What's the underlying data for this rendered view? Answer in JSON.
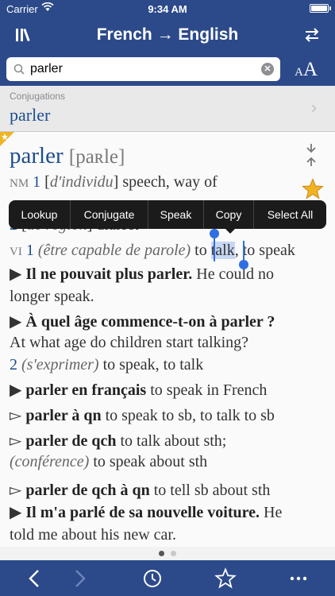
{
  "status": {
    "carrier": "Carrier",
    "time": "9:34 AM"
  },
  "nav": {
    "title": "French → English"
  },
  "search": {
    "value": "parler",
    "placeholder": ""
  },
  "text_size": {
    "small": "A",
    "big": "A"
  },
  "conjugations": {
    "label": "Conjugations",
    "word": "parler"
  },
  "entry": {
    "headword": "parler",
    "pronunciation": "[paʀle]",
    "nm": {
      "pos": "NM",
      "n1": "1",
      "gloss1": "[",
      "ctx1": "d'individu",
      "gloss1b": "] speech, way of"
    },
    "nm2": {
      "n2": "2",
      "gloss2": "[",
      "ctx2": "de région",
      "gloss2b": "] dialect"
    },
    "vi": {
      "pos": "VI",
      "n1": "1",
      "ctx": "(être capable de parole)",
      "before": " to ",
      "selected": "talk",
      "after": ", to speak"
    },
    "ex1": {
      "fr": "Il ne pouvait plus parler.",
      "en_a": " He could no",
      "en_b": "longer speak."
    },
    "ex2": {
      "fr": "À quel âge commence-t-on à parler ?",
      "en": "At what age do children start talking?"
    },
    "s2": {
      "n": "2",
      "ctx": "(s'exprimer)",
      "tr": " to speak, to talk"
    },
    "ex3": {
      "fr": "parler en français",
      "en": " to speak in French"
    },
    "p1": {
      "fr": "parler à qn",
      "en": " to speak to sb, to talk to sb"
    },
    "p2": {
      "fr": "parler de qch",
      "en": " to talk about sth;"
    },
    "p2b": {
      "ctx": "(conférence)",
      "en": " to speak about sth"
    },
    "p3": {
      "fr": "parler de qch à qn",
      "en": " to tell sb about sth"
    },
    "ex4": {
      "fr": "Il m'a parlé de sa nouvelle voiture.",
      "en_a": " He",
      "en_b": "told me about his new car."
    }
  },
  "context_menu": [
    "Lookup",
    "Conjugate",
    "Speak",
    "Copy",
    "Select All"
  ],
  "toolbar": {
    "icons": [
      "back-icon",
      "forward-icon",
      "history-icon",
      "favorites-icon",
      "more-icon"
    ]
  },
  "colors": {
    "brand": "#2c4a8a",
    "accent": "#1f4d8c",
    "selection": "#2f6ee2",
    "star": "#f0b323"
  }
}
